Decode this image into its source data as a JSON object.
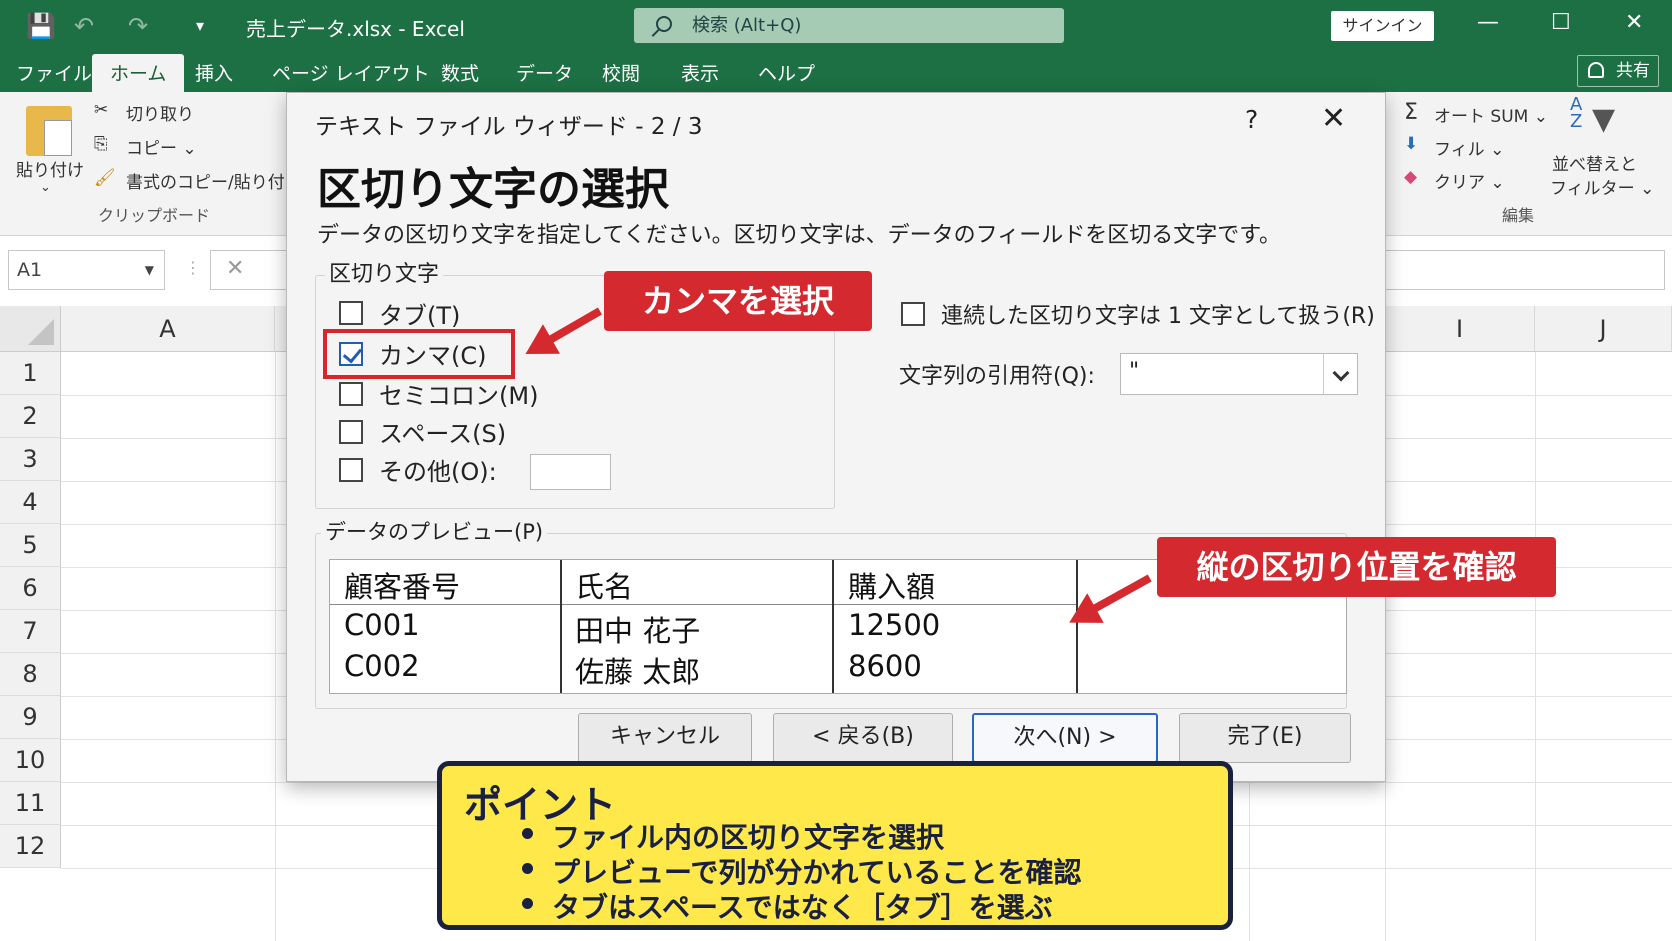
{
  "window": {
    "title": "売上データ.xlsx  -  Excel",
    "search_placeholder": "検索 (Alt+Q)",
    "signin": "サインイン",
    "minimize": "—",
    "maximize": "☐",
    "close": "✕"
  },
  "menu": {
    "tabs": [
      "ファイル",
      "ホーム",
      "挿入",
      "ページ レイアウト",
      "数式",
      "データ",
      "校閲",
      "表示",
      "ヘルプ"
    ],
    "active": "ホーム",
    "share": "共有"
  },
  "ribbon": {
    "paste": "貼り付け",
    "cut": "切り取り",
    "copy": "コピー ⌄",
    "format_painter": "書式のコピー/貼り付け",
    "clipboard_group": "クリップボード",
    "autosum": "オート SUM ⌄",
    "fill": "フィル ⌄",
    "clear": "クリア ⌄",
    "sort_filter_1": "並べ替えと",
    "sort_filter_2": "フィルター ⌄",
    "edit_group": "編集"
  },
  "formula_bar": {
    "name_box": "A1",
    "cancel": "✕"
  },
  "grid": {
    "columns": [
      "A",
      "I",
      "J"
    ],
    "rows": [
      "1",
      "2",
      "3",
      "4",
      "5",
      "6",
      "7",
      "8",
      "9",
      "10",
      "11",
      "12"
    ]
  },
  "dialog": {
    "title": "テキスト ファイル ウィザード - 2 / 3",
    "help": "?",
    "close": "✕",
    "heading": "区切り文字の選択",
    "description": "データの区切り文字を指定してください。区切り文字は、データのフィールドを区切る文字です。",
    "delimiter_legend": "区切り文字",
    "delimiters": [
      {
        "label": "タブ(T)",
        "checked": false
      },
      {
        "label": "カンマ(C)",
        "checked": true
      },
      {
        "label": "セミコロン(M)",
        "checked": false
      },
      {
        "label": "スペース(S)",
        "checked": false
      },
      {
        "label": "その他(O):",
        "checked": false
      }
    ],
    "consecutive": {
      "label": "連続した区切り文字は 1 文字として扱う(R)",
      "checked": false
    },
    "qualifier_label": "文字列の引用符(Q):",
    "qualifier_value": "\"",
    "preview_legend": "データのプレビュー(P)",
    "preview": {
      "headers": [
        "顧客番号",
        "氏名",
        "購入額"
      ],
      "rows": [
        [
          "C001",
          "田中 花子",
          "12500"
        ],
        [
          "C002",
          "佐藤 太郎",
          "8600"
        ]
      ]
    },
    "buttons": {
      "cancel": "キャンセル",
      "back": "< 戻る(B)",
      "next": "次へ(N) >",
      "finish": "完了(E)"
    }
  },
  "annotations": {
    "comma_callout": "カンマを選択",
    "preview_callout": "縦の区切り位置を確認",
    "accent_color": "#d42a2f"
  },
  "point_box": {
    "title": "ポイント",
    "items": [
      "ファイル内の区切り文字を選択",
      "プレビューで列が分かれていることを確認",
      "タブはスペースではなく［タブ］を選ぶ"
    ],
    "background": "#ffe94a"
  }
}
